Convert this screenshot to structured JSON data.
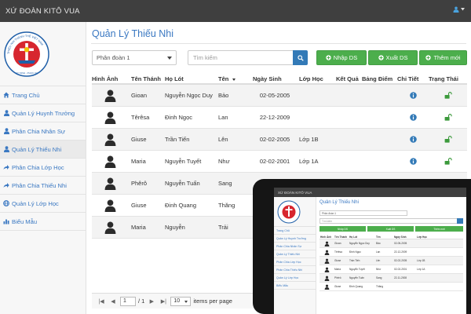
{
  "app": {
    "title": "XỨ ĐOÀN KITÔ VUA"
  },
  "logo": {
    "ring_text": "THIẾU NHI THÁNH THỂ VIỆT NAM",
    "motto": "HY SINH - PHỤC VỤ"
  },
  "sidebar": {
    "items": [
      {
        "label": "Trang Chủ",
        "icon": "home-icon"
      },
      {
        "label": "Quản Lý Huynh Trưởng",
        "icon": "user-icon"
      },
      {
        "label": "Phân Chia Nhân Sự",
        "icon": "user-icon"
      },
      {
        "label": "Quản Lý Thiếu Nhi",
        "icon": "user-icon"
      },
      {
        "label": "Phân Chia Lớp Học",
        "icon": "share-icon"
      },
      {
        "label": "Phân Chia Thiếu Nhi",
        "icon": "share-icon"
      },
      {
        "label": "Quản Lý Lớp Học",
        "icon": "globe-icon"
      },
      {
        "label": "Biểu Mẫu",
        "icon": "chart-icon"
      }
    ]
  },
  "main": {
    "title": "Quản Lý Thiếu Nhi",
    "filter_value": "Phân đoàn 1",
    "search_placeholder": "Tìm kiếm",
    "buttons": {
      "import": "Nhập DS",
      "export": "Xuất DS",
      "add": "Thêm mới"
    }
  },
  "table": {
    "headers": [
      "Hình Ảnh",
      "Tên Thánh",
      "Họ Lót",
      "Tên",
      "Ngày Sinh",
      "Lớp Học",
      "Kết Quả",
      "Bảng Điểm",
      "Chi Tiết",
      "Trạng Thái"
    ],
    "rows": [
      {
        "saint": "Gioan",
        "last": "Nguyễn Ngọc Duy",
        "first": "Bảo",
        "dob": "02-05-2005",
        "class": ""
      },
      {
        "saint": "Têrêsa",
        "last": "Đinh Ngọc",
        "first": "Lan",
        "dob": "22-12-2009",
        "class": ""
      },
      {
        "saint": "Giuse",
        "last": "Trần Tiến",
        "first": "Lên",
        "dob": "02-02-2005",
        "class": "Lớp 1B"
      },
      {
        "saint": "Maria",
        "last": "Nguyễn Tuyết",
        "first": "Như",
        "dob": "02-02-2001",
        "class": "Lớp 1A"
      },
      {
        "saint": "Phêrô",
        "last": "Nguyễn Tuấn",
        "first": "Sang",
        "dob": "",
        "class": ""
      },
      {
        "saint": "Giuse",
        "last": "Đinh Quang",
        "first": "Thăng",
        "dob": "",
        "class": ""
      },
      {
        "saint": "Maria",
        "last": "Nguyễn",
        "first": "Trải",
        "dob": "",
        "class": ""
      }
    ]
  },
  "pager": {
    "current_page": "1",
    "total": "/ 1",
    "page_size": "10",
    "label": "items per page"
  },
  "tablet": {
    "headers": [
      "Hình Ảnh",
      "Tên Thánh",
      "Họ Lót",
      "Tên",
      "Ngày Sinh",
      "Lớp Học"
    ],
    "rows": [
      {
        "saint": "Gioan",
        "last": "Nguyễn Ngọc Duy",
        "first": "Bảo",
        "dob": "02-05-2005",
        "class": ""
      },
      {
        "saint": "Têrêsa",
        "last": "Đinh Ngọc",
        "first": "Lan",
        "dob": "22-12-2009",
        "class": ""
      },
      {
        "saint": "Giuse",
        "last": "Trần Tiến",
        "first": "Lên",
        "dob": "02-02-2005",
        "class": "Lớp 1B"
      },
      {
        "saint": "Maria",
        "last": "Nguyễn Tuyết",
        "first": "Như",
        "dob": "02-02-2001",
        "class": "Lớp 1A"
      },
      {
        "saint": "Phêrô",
        "last": "Nguyễn Tuấn",
        "first": "Sang",
        "dob": "22-11-2008",
        "class": ""
      },
      {
        "saint": "Giuse",
        "last": "Đinh Quang",
        "first": "Thăng",
        "dob": "",
        "class": ""
      }
    ]
  },
  "colors": {
    "navbar": "#3f3f3f",
    "accent": "#3a78c2",
    "green": "#4cae4c",
    "primary": "#337ab7"
  }
}
